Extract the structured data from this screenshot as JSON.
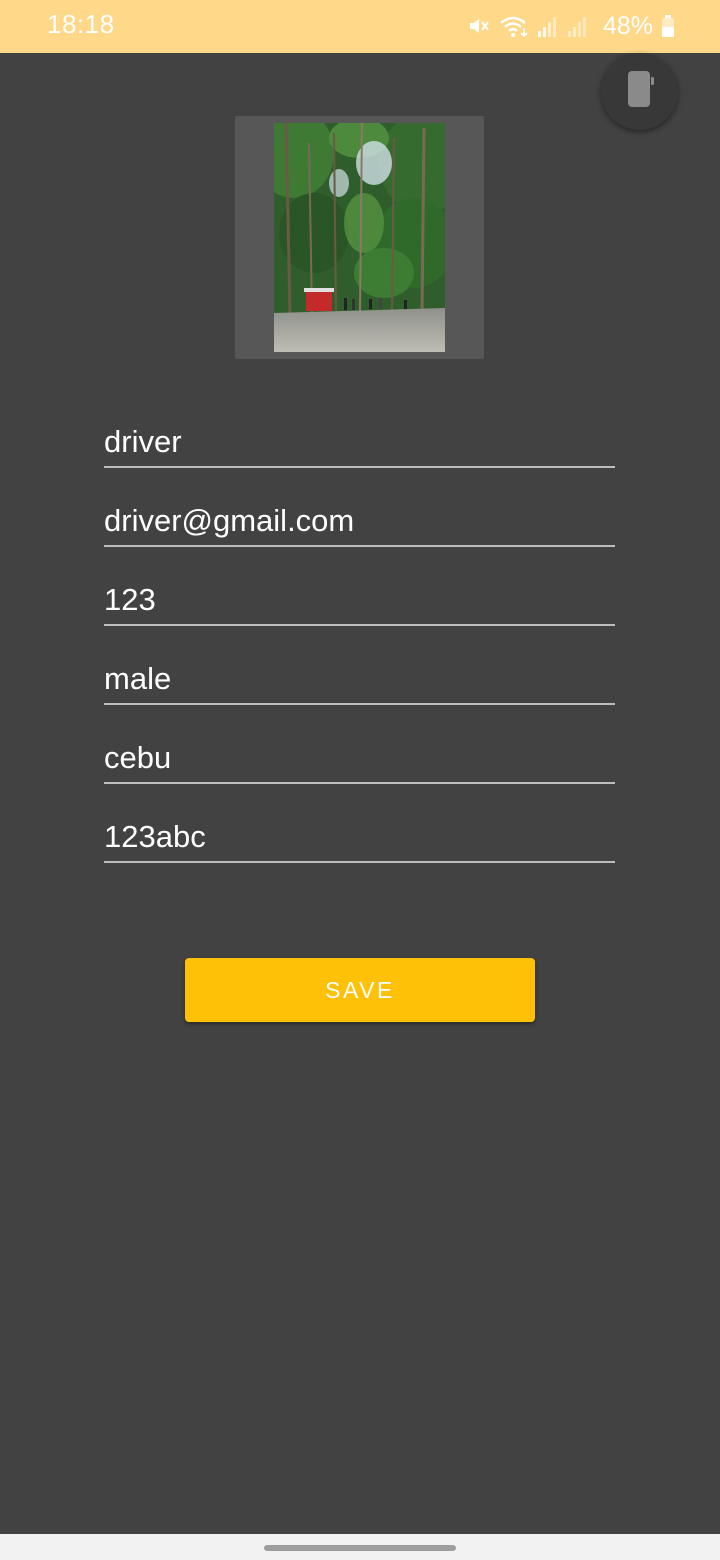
{
  "status_bar": {
    "time": "18:18",
    "battery": "48%",
    "background": "#FFD88A",
    "icons": [
      "mute-icon",
      "wifi-icon",
      "signal-icon",
      "signal-icon",
      "battery-icon"
    ]
  },
  "form": {
    "fields": [
      {
        "value": "driver"
      },
      {
        "value": "driver@gmail.com"
      },
      {
        "value": "123"
      },
      {
        "value": "male"
      },
      {
        "value": "cebu"
      },
      {
        "value": "123abc"
      }
    ],
    "save_label": "SAVE",
    "accent": "#FFC107"
  },
  "theme": {
    "background": "#424242"
  }
}
